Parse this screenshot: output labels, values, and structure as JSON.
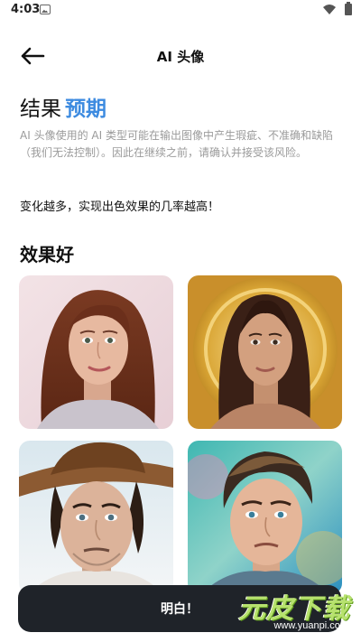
{
  "status_bar": {
    "time": "4:03"
  },
  "header": {
    "title": "AI 头像"
  },
  "headline": {
    "prefix": "结果",
    "accent": "预期"
  },
  "description": "AI 头像使用的 AI 类型可能在输出图像中产生瑕疵、不准确和缺陷（我们无法控制）。因此在继续之前，请确认并接受该风险。",
  "tip": "变化越多，实现出色效果的几率越高！",
  "section": {
    "title": "效果好"
  },
  "confirm_button": {
    "label": "明白！"
  },
  "watermark": {
    "text": "元皮下载",
    "url": "www.yuanpi.com"
  },
  "colors": {
    "accent": "#3d8be0",
    "button": "#1f2329"
  }
}
